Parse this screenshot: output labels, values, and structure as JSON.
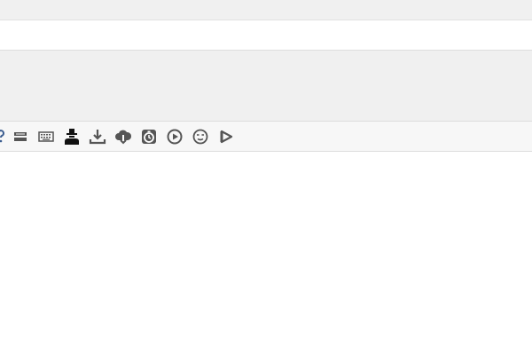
{
  "toolbar": {
    "icons": [
      {
        "name": "help-icon"
      },
      {
        "name": "panel-icon"
      },
      {
        "name": "keyboard-icon"
      },
      {
        "name": "spy-icon"
      },
      {
        "name": "download-tray-icon"
      },
      {
        "name": "cloud-download-icon"
      },
      {
        "name": "timer-icon"
      },
      {
        "name": "play-circle-icon"
      },
      {
        "name": "face-icon"
      },
      {
        "name": "play-outline-icon"
      }
    ],
    "icon_color": "#555555"
  }
}
